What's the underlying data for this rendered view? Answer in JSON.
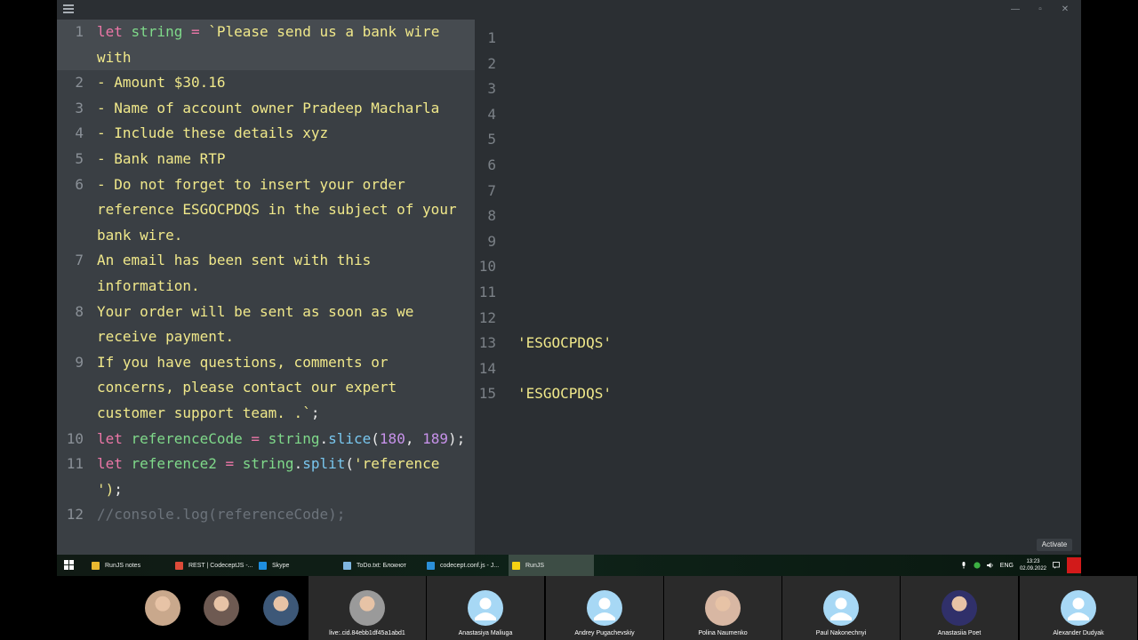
{
  "window": {
    "minimize": "—",
    "maximize": "▫",
    "close": "✕"
  },
  "editor": {
    "lines": [
      {
        "n": "1",
        "active": true,
        "segments": [
          {
            "t": "let ",
            "c": "kw"
          },
          {
            "t": "string",
            "c": "var"
          },
          {
            "t": " = ",
            "c": "kw"
          },
          {
            "t": "`Please send us a bank wire with",
            "c": "str"
          }
        ]
      },
      {
        "n": "2",
        "segments": [
          {
            "t": "- Amount $30.16",
            "c": "str"
          }
        ]
      },
      {
        "n": "3",
        "segments": [
          {
            "t": "- Name of account owner Pradeep Macharla",
            "c": "str"
          }
        ]
      },
      {
        "n": "4",
        "segments": [
          {
            "t": "- Include these details xyz",
            "c": "str"
          }
        ]
      },
      {
        "n": "5",
        "segments": [
          {
            "t": "- Bank name RTP",
            "c": "str"
          }
        ]
      },
      {
        "n": "6",
        "segments": [
          {
            "t": "- Do not forget to insert your order reference ESGOCPDQS in the subject of your bank wire.",
            "c": "str"
          }
        ]
      },
      {
        "n": "7",
        "segments": [
          {
            "t": "An email has been sent with this information.",
            "c": "str"
          }
        ]
      },
      {
        "n": "8",
        "segments": [
          {
            "t": "Your order will be sent as soon as we receive payment.",
            "c": "str"
          }
        ]
      },
      {
        "n": "9",
        "segments": [
          {
            "t": "If you have questions, comments or concerns, please contact our expert customer support team. .`",
            "c": "str"
          },
          {
            "t": ";",
            "c": "plain"
          }
        ]
      },
      {
        "n": "10",
        "segments": [
          {
            "t": "let ",
            "c": "kw"
          },
          {
            "t": "referenceCode",
            "c": "var"
          },
          {
            "t": " = ",
            "c": "kw"
          },
          {
            "t": "string",
            "c": "var"
          },
          {
            "t": ".",
            "c": "plain"
          },
          {
            "t": "slice",
            "c": "fn"
          },
          {
            "t": "(",
            "c": "plain"
          },
          {
            "t": "180",
            "c": "num"
          },
          {
            "t": ", ",
            "c": "plain"
          },
          {
            "t": "189",
            "c": "num"
          },
          {
            "t": ");",
            "c": "plain"
          }
        ]
      },
      {
        "n": "11",
        "segments": [
          {
            "t": "let ",
            "c": "kw"
          },
          {
            "t": "reference2",
            "c": "var"
          },
          {
            "t": " = ",
            "c": "kw"
          },
          {
            "t": "string",
            "c": "var"
          },
          {
            "t": ".",
            "c": "plain"
          },
          {
            "t": "split",
            "c": "fn"
          },
          {
            "t": "(",
            "c": "plain"
          },
          {
            "t": "'reference ')",
            "c": "str"
          },
          {
            "t": ";",
            "c": "plain"
          }
        ]
      },
      {
        "n": "12",
        "segments": [
          {
            "t": "//console.log(referenceCode);",
            "c": "cmt"
          }
        ]
      }
    ]
  },
  "output": {
    "lines": [
      {
        "n": "1",
        "v": ""
      },
      {
        "n": "2",
        "v": ""
      },
      {
        "n": "3",
        "v": ""
      },
      {
        "n": "4",
        "v": ""
      },
      {
        "n": "5",
        "v": ""
      },
      {
        "n": "6",
        "v": ""
      },
      {
        "n": "7",
        "v": ""
      },
      {
        "n": "8",
        "v": ""
      },
      {
        "n": "9",
        "v": ""
      },
      {
        "n": "10",
        "v": ""
      },
      {
        "n": "11",
        "v": ""
      },
      {
        "n": "12",
        "v": ""
      },
      {
        "n": "13",
        "v": "'ESGOCPDQS'"
      },
      {
        "n": "14",
        "v": ""
      },
      {
        "n": "15",
        "v": "'ESGOCPDQS'"
      }
    ]
  },
  "activate_label": "Activate",
  "taskbar": {
    "items": [
      {
        "label": "RunJS notes",
        "icon": "folder-icon",
        "color": "#e8b730",
        "active": false
      },
      {
        "label": "REST | CodeceptJS -...",
        "icon": "chrome-icon",
        "color": "#dd4b39",
        "active": false
      },
      {
        "label": "Skype",
        "icon": "skype-icon",
        "color": "#1e8ee0",
        "active": false
      },
      {
        "label": "ToDo.txt: Блокнот",
        "icon": "notepad-icon",
        "color": "#7fb6e0",
        "active": false
      },
      {
        "label": "codecept.conf.js - J...",
        "icon": "vscode-icon",
        "color": "#2b8fd8",
        "active": false
      },
      {
        "label": "RunJS",
        "icon": "runjs-icon",
        "color": "#f5d213",
        "active": true
      }
    ],
    "tray": {
      "lang": "ENG",
      "time": "13:23",
      "date": "02.09.2022"
    }
  },
  "participants": [
    {
      "name": "",
      "avatar": "photo",
      "color": "#c9a88c",
      "small": true
    },
    {
      "name": "",
      "avatar": "photo",
      "color": "#6e5a52",
      "small": true
    },
    {
      "name": "",
      "avatar": "photo",
      "color": "#3d5878",
      "small": true
    },
    {
      "name": "live:.cid.84ebb1df45a1abd1",
      "avatar": "photo",
      "color": "#9a9a9a"
    },
    {
      "name": "Anastasiya Maliuga",
      "avatar": "generic"
    },
    {
      "name": "Andrey Pugachevskiy",
      "avatar": "generic"
    },
    {
      "name": "Polina Naumenko",
      "avatar": "photo",
      "color": "#d8b7a3"
    },
    {
      "name": "Paul Nakonechnyi",
      "avatar": "generic"
    },
    {
      "name": "Anastasiia Poet",
      "avatar": "photo",
      "color": "#30306a"
    },
    {
      "name": "Alexander Dudyak",
      "avatar": "generic"
    }
  ]
}
